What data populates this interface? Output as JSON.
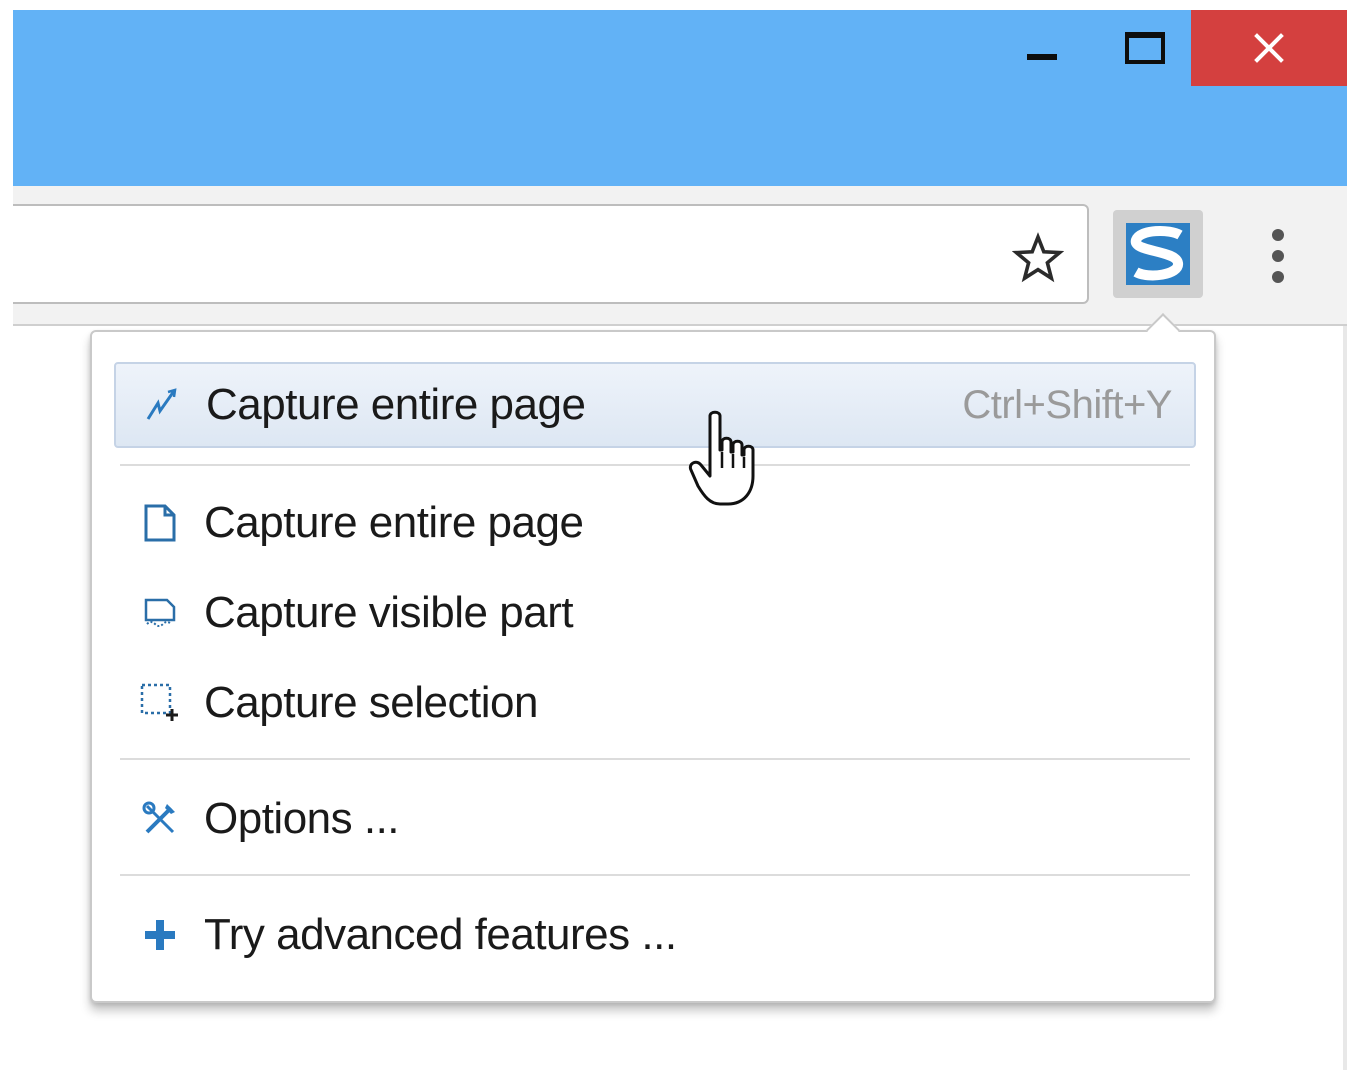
{
  "window": {
    "controls": [
      "minimize-icon",
      "maximize-icon",
      "close-icon"
    ],
    "colors": {
      "titlebar": "#62b2f6",
      "close": "#d4403f"
    }
  },
  "toolbar": {
    "icons": [
      "star-icon",
      "screenshot-extension-icon",
      "more-vert-icon"
    ],
    "extension_letter": "S"
  },
  "menu": {
    "items": [
      {
        "icon": "capture-entire-page-quick-icon",
        "label": "Capture entire page",
        "shortcut": "Ctrl+Shift+Y",
        "highlighted": true
      },
      {
        "icon": "page-icon",
        "label": "Capture entire page"
      },
      {
        "icon": "visible-part-icon",
        "label": "Capture visible part"
      },
      {
        "icon": "selection-icon",
        "label": "Capture selection"
      },
      {
        "icon": "tools-icon",
        "label": "Options ..."
      },
      {
        "icon": "plus-icon",
        "label": "Try advanced features ..."
      }
    ],
    "accent": "#2a7ac0"
  },
  "pointer": {
    "icon": "hand-cursor-icon"
  }
}
